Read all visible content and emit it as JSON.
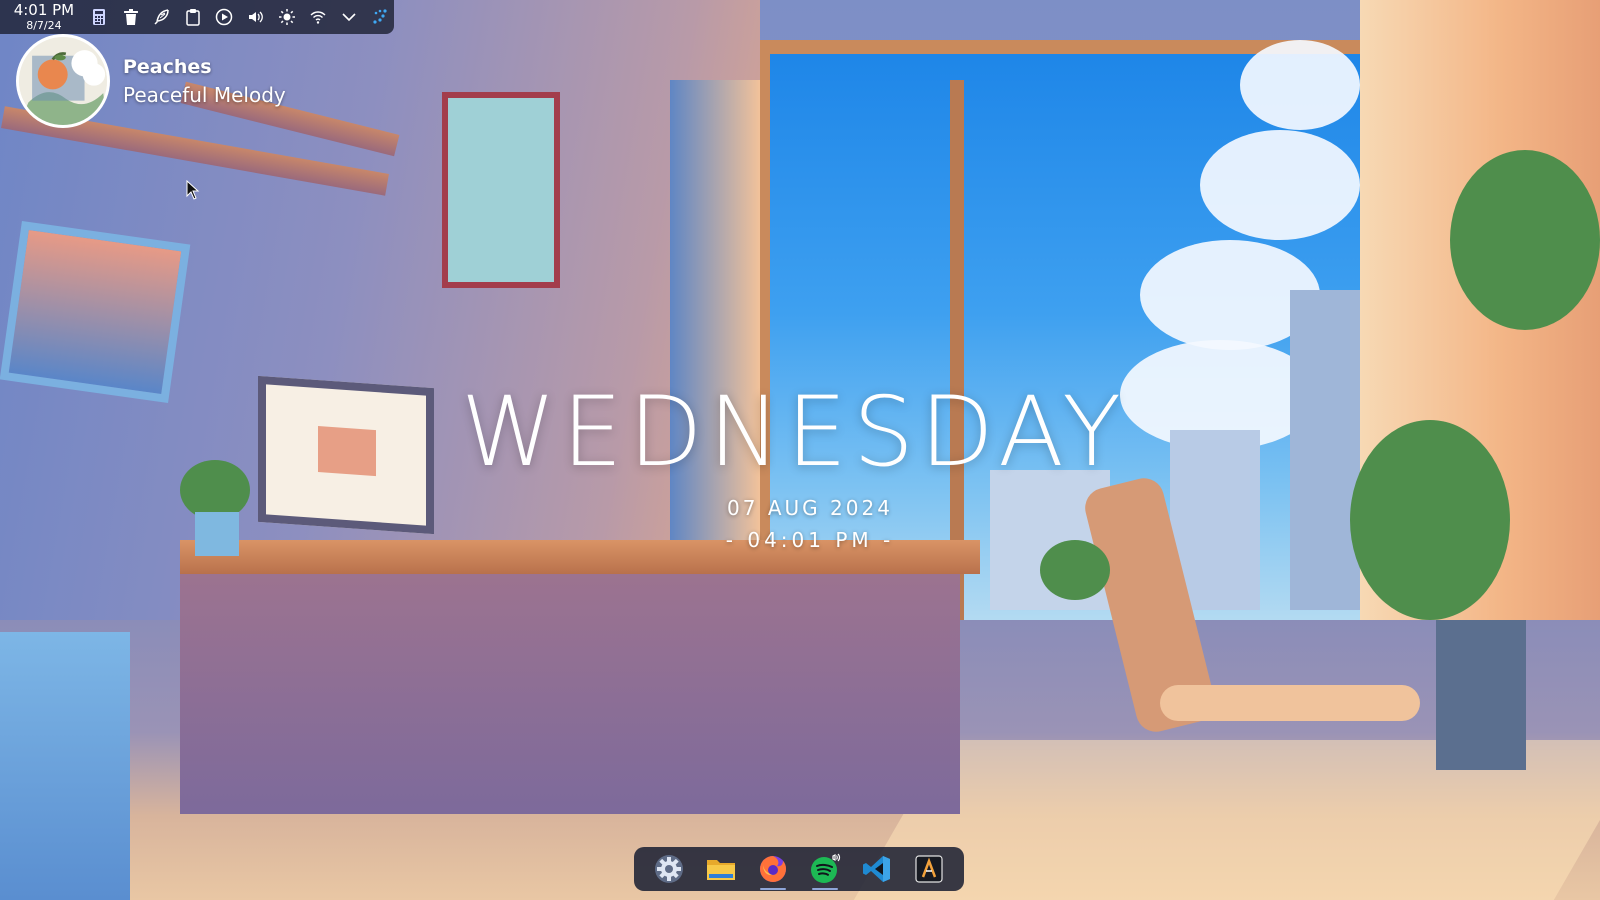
{
  "top_panel": {
    "clock": {
      "time": "4:01 PM",
      "date": "8/7/24"
    },
    "tray_icons": [
      "calculator-icon",
      "trash-icon",
      "feather-icon",
      "clipboard-icon",
      "media-play-icon",
      "volume-icon",
      "brightness-icon",
      "wifi-icon",
      "chevron-down-icon",
      "app-launcher-icon"
    ]
  },
  "media_widget": {
    "title": "Peaches",
    "artist": "Peaceful Melody"
  },
  "date_widget": {
    "day": "WEDNESDAY",
    "date": "07 AUG 2024",
    "time": "- 04:01 PM -"
  },
  "dock": {
    "apps": [
      "settings-icon",
      "file-manager-icon",
      "firefox-icon",
      "spotify-icon",
      "vscode-icon",
      "text-editor-icon"
    ]
  },
  "colors": {
    "panel_bg": "#1e2234",
    "accent": "#8fa6d8",
    "sky": "#1e86e8"
  }
}
